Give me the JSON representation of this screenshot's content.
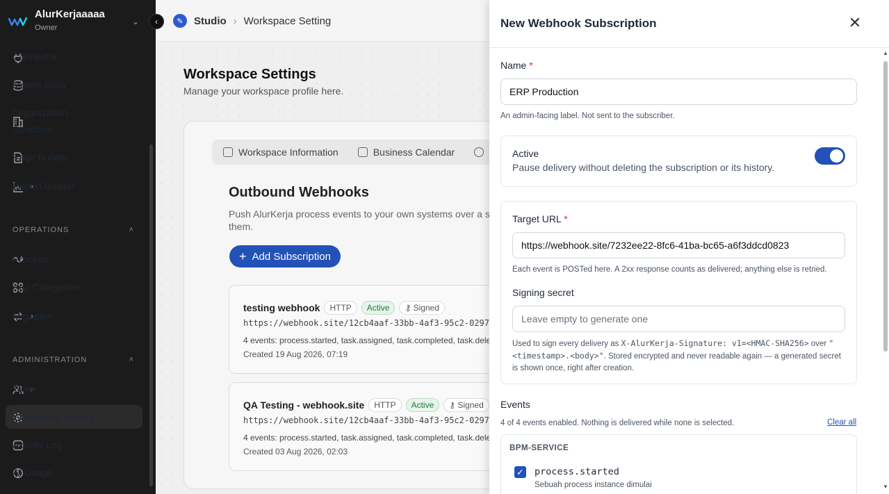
{
  "sidebar": {
    "workspace_name": "AlurKerjaaaaa",
    "workspace_role": "Owner",
    "items_top": [
      {
        "label": "Connector"
      },
      {
        "label": "Master Data"
      },
      {
        "label": "Organization Structure"
      },
      {
        "label": "Page Builder"
      },
      {
        "label": "Report Builder"
      }
    ],
    "section_operations": "OPERATIONS",
    "items_operations": [
      {
        "label": "Process"
      },
      {
        "label": "App Categories"
      },
      {
        "label": "Migration"
      }
    ],
    "section_administration": "ADMINISTRATION",
    "items_admin": [
      {
        "label": "Team"
      },
      {
        "label": "Workspace Setting"
      },
      {
        "label": "Activity Log"
      },
      {
        "label": "AI Usage"
      }
    ]
  },
  "breadcrumb": {
    "root": "Studio",
    "current": "Workspace Setting"
  },
  "page": {
    "title": "Workspace Settings",
    "subtitle": "Manage your workspace profile here.",
    "tabs": [
      "Workspace Information",
      "Business Calendar"
    ],
    "webhooks_title": "Outbound Webhooks",
    "webhooks_desc": "Push AlurKerja process events to your own systems over a si",
    "webhooks_desc2": "them.",
    "add_label": "Add Subscription",
    "subscriptions": [
      {
        "name": "testing webhook",
        "protocol": "HTTP",
        "status": "Active",
        "signed": "Signed",
        "url": "https://webhook.site/12cb4aaf-33bb-4af3-95c2-0297",
        "events": "4 events: process.started, task.assigned, task.completed, task.dele",
        "created": "Created 19 Aug 2026, 07:19"
      },
      {
        "name": "QA Testing - webhook.site",
        "protocol": "HTTP",
        "status": "Active",
        "signed": "Signed",
        "url": "https://webhook.site/12cb4aaf-33bb-4af3-95c2-0297",
        "events": "4 events: process.started, task.assigned, task.completed, task.dele",
        "created": "Created 03 Aug 2026, 02:03"
      }
    ]
  },
  "panel": {
    "title": "New Webhook Subscription",
    "name_label": "Name",
    "name_value": "ERP Production",
    "name_hint": "An admin-facing label. Not sent to the subscriber.",
    "active_label": "Active",
    "active_desc": "Pause delivery without deleting the subscription or its history.",
    "active_on": true,
    "target_label": "Target URL",
    "target_value": "https://webhook.site/7232ee22-8fc6-41ba-bc65-a6f3ddcd0823",
    "target_hint": "Each event is POSTed here. A 2xx response counts as delivered; anything else is retried.",
    "secret_label": "Signing secret",
    "secret_placeholder": "Leave empty to generate one",
    "secret_hint_1": "Used to sign every delivery as",
    "secret_hint_code1": "X-AlurKerja-Signature: v1=<HMAC-SHA256>",
    "secret_hint_2": "over",
    "secret_hint_code2": "\"<timestamp>.<body>\"",
    "secret_hint_3": ". Stored encrypted and never readable again — a generated secret is shown once, right after creation.",
    "events_label": "Events",
    "events_summary": "4 of 4 events enabled. Nothing is delivered while none is selected.",
    "clear_all": "Clear all",
    "group_label": "BPM-SERVICE",
    "event_name": "process.started",
    "event_desc": "Sebuah process instance dimulai"
  },
  "colors": {
    "accent": "#2251b8",
    "sidebar_bg": "#1b1b1b",
    "active_green": "#1f7a3a"
  }
}
